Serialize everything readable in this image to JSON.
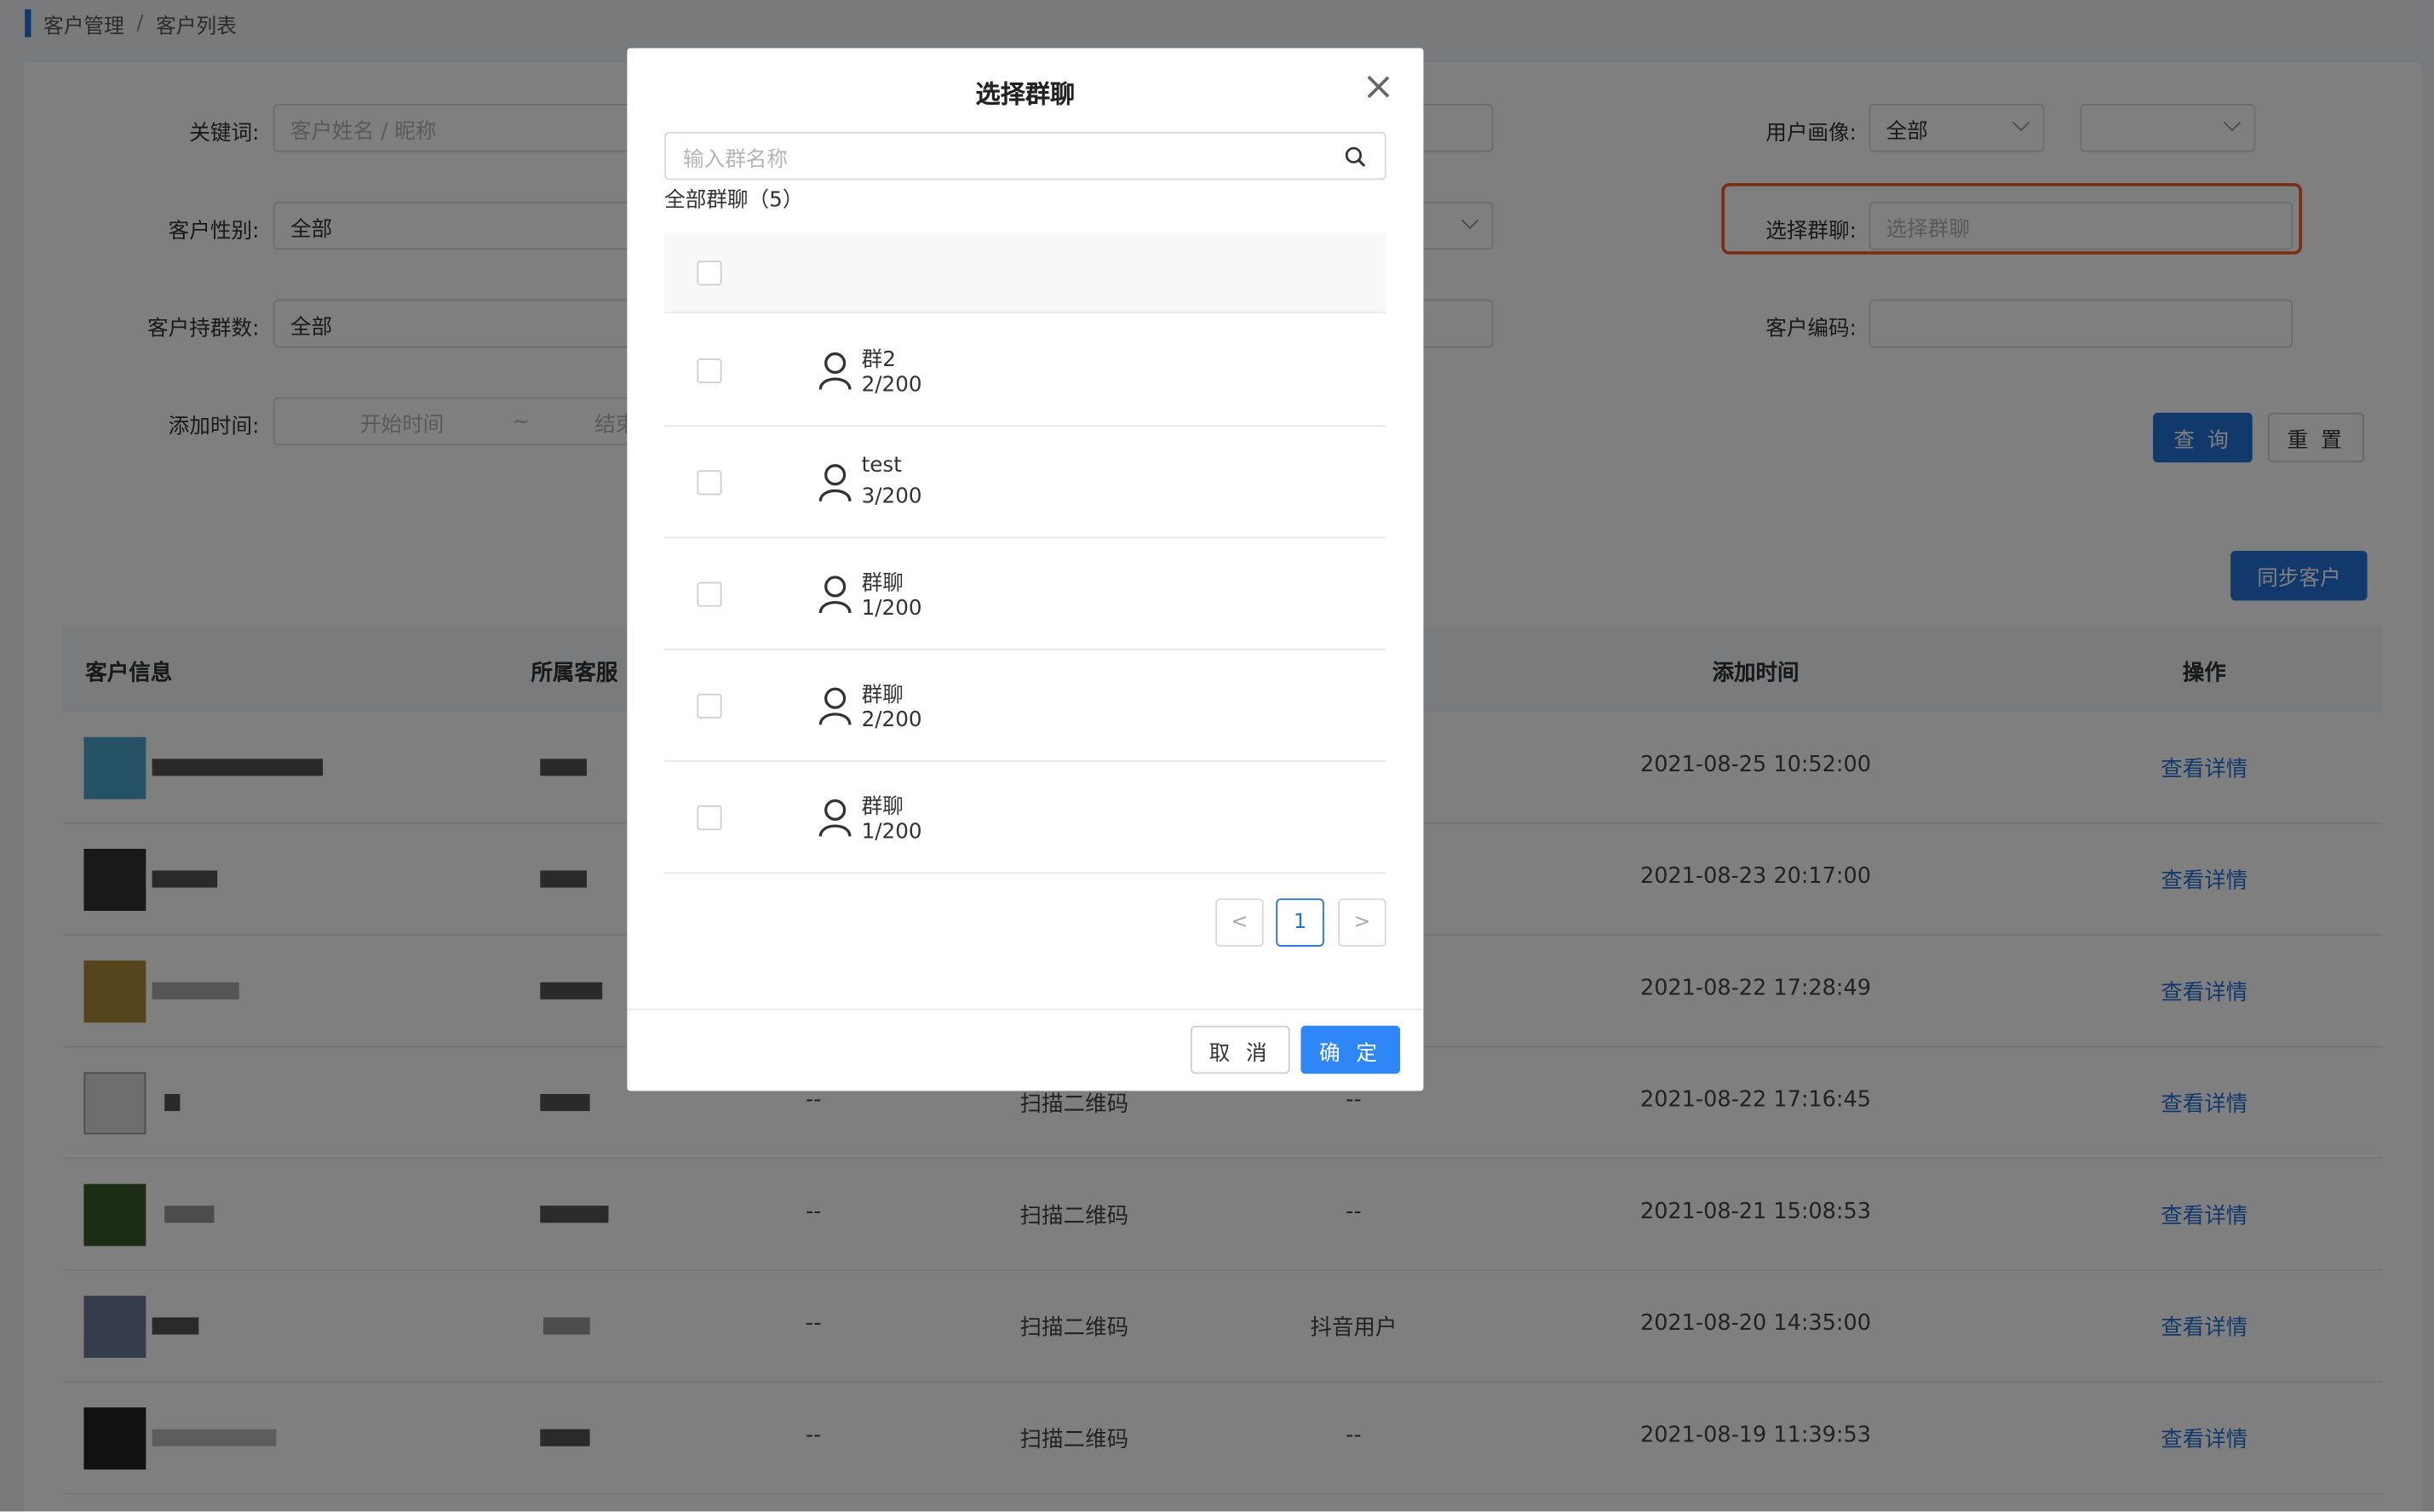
{
  "breadcrumb": {
    "parent": "客户管理",
    "separator": "/",
    "current": "客户列表"
  },
  "filters": {
    "keyword_label": "关键词:",
    "keyword_placeholder": "客户姓名 / 昵称",
    "gender_label": "客户性别:",
    "gender_value": "全部",
    "group_count_label": "客户持群数:",
    "group_count_value": "全部",
    "add_time_label": "添加时间:",
    "start_placeholder": "开始时间",
    "range_sep": "~",
    "end_placeholder": "结束",
    "persona_label": "用户画像:",
    "persona_value": "全部",
    "persona_value2": "",
    "group_label": "选择群聊:",
    "group_placeholder": "选择群聊",
    "code_label": "客户编码:",
    "code_value": ""
  },
  "buttons": {
    "query": "查 询",
    "reset": "重 置",
    "sync": "同步客户"
  },
  "table": {
    "headers": {
      "customer": "客户信息",
      "agent": "所属客服",
      "add_time": "添加时间",
      "action": "操作"
    },
    "rows": [
      {
        "col3": "",
        "col4": "",
        "col5": "",
        "time": "2021-08-25 10:52:00",
        "action": "查看详情"
      },
      {
        "col3": "",
        "col4": "",
        "col5": "",
        "time": "2021-08-23 20:17:00",
        "action": "查看详情"
      },
      {
        "col3": "",
        "col4": "",
        "col5": "",
        "time": "2021-08-22 17:28:49",
        "action": "查看详情"
      },
      {
        "col3": "--",
        "col4": "扫描二维码",
        "col5": "--",
        "time": "2021-08-22 17:16:45",
        "action": "查看详情"
      },
      {
        "col3": "--",
        "col4": "扫描二维码",
        "col5": "--",
        "time": "2021-08-21 15:08:53",
        "action": "查看详情"
      },
      {
        "col3": "--",
        "col4": "扫描二维码",
        "col5": "抖音用户",
        "time": "2021-08-20 14:35:00",
        "action": "查看详情"
      },
      {
        "col3": "--",
        "col4": "扫描二维码",
        "col5": "--",
        "time": "2021-08-19 11:39:53",
        "action": "查看详情"
      }
    ]
  },
  "modal": {
    "title": "选择群聊",
    "search_placeholder": "输入群名称",
    "count_text": "全部群聊（5）",
    "groups": [
      {
        "name": "群2",
        "count": "2/200"
      },
      {
        "name": "test",
        "count": "3/200"
      },
      {
        "name": "群聊",
        "count": "1/200"
      },
      {
        "name": "群聊",
        "count": "2/200"
      },
      {
        "name": "群聊",
        "count": "1/200"
      }
    ],
    "pagination": {
      "prev": "<",
      "page": "1",
      "next": ">"
    },
    "cancel": "取 消",
    "confirm": "确 定"
  },
  "colors": {
    "primary": "#2272d6",
    "highlight": "#f05a28",
    "mask": "rgba(0,0,0,0.5)"
  }
}
